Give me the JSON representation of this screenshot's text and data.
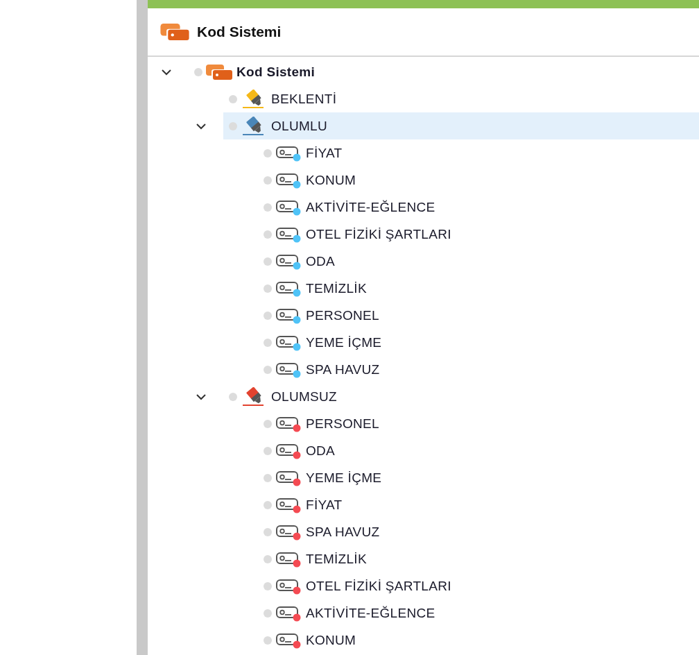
{
  "panel": {
    "title": "Kod Sistemi"
  },
  "tree": {
    "label": "Kod Sistemi",
    "kind": "root",
    "expanded": true,
    "selected": false,
    "children": [
      {
        "label": "BEKLENTİ",
        "kind": "category",
        "color": "#f5b818",
        "expanded": false,
        "selected": false
      },
      {
        "label": "OLUMLU",
        "kind": "category",
        "color": "#4a86b8",
        "expanded": true,
        "selected": true,
        "children": [
          {
            "label": "FİYAT",
            "kind": "code",
            "color": "#4fc3f7",
            "selected": false
          },
          {
            "label": "KONUM",
            "kind": "code",
            "color": "#4fc3f7",
            "selected": false
          },
          {
            "label": "AKTİVİTE-EĞLENCE",
            "kind": "code",
            "color": "#4fc3f7",
            "selected": false
          },
          {
            "label": "OTEL FİZİKİ ŞARTLARI",
            "kind": "code",
            "color": "#4fc3f7",
            "selected": false
          },
          {
            "label": "ODA",
            "kind": "code",
            "color": "#4fc3f7",
            "selected": false
          },
          {
            "label": "TEMİZLİK",
            "kind": "code",
            "color": "#4fc3f7",
            "selected": false
          },
          {
            "label": "PERSONEL",
            "kind": "code",
            "color": "#4fc3f7",
            "selected": false
          },
          {
            "label": "YEME İÇME",
            "kind": "code",
            "color": "#4fc3f7",
            "selected": false
          },
          {
            "label": "SPA HAVUZ",
            "kind": "code",
            "color": "#4fc3f7",
            "selected": false
          }
        ]
      },
      {
        "label": "OLUMSUZ",
        "kind": "category",
        "color": "#e2432f",
        "expanded": true,
        "selected": false,
        "children": [
          {
            "label": "PERSONEL",
            "kind": "code",
            "color": "#f44a52",
            "selected": false
          },
          {
            "label": "ODA",
            "kind": "code",
            "color": "#f44a52",
            "selected": false
          },
          {
            "label": "YEME İÇME",
            "kind": "code",
            "color": "#f44a52",
            "selected": false
          },
          {
            "label": "FİYAT",
            "kind": "code",
            "color": "#f44a52",
            "selected": false
          },
          {
            "label": "SPA HAVUZ",
            "kind": "code",
            "color": "#f44a52",
            "selected": false
          },
          {
            "label": "TEMİZLİK",
            "kind": "code",
            "color": "#f44a52",
            "selected": false
          },
          {
            "label": "OTEL FİZİKİ ŞARTLARI",
            "kind": "code",
            "color": "#f44a52",
            "selected": false
          },
          {
            "label": "AKTİVİTE-EĞLENCE",
            "kind": "code",
            "color": "#f44a52",
            "selected": false
          },
          {
            "label": "KONUM",
            "kind": "code",
            "color": "#f44a52",
            "selected": false
          }
        ]
      }
    ]
  }
}
